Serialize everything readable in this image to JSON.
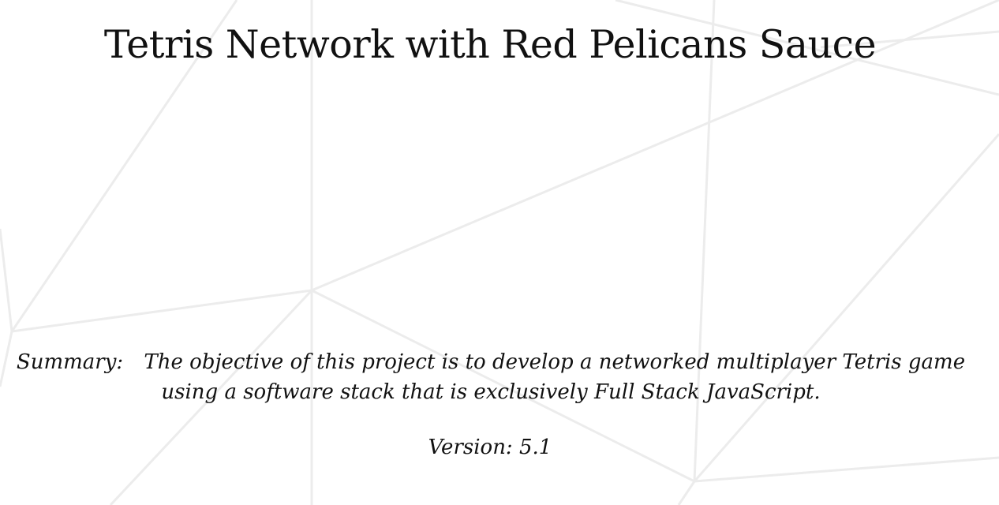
{
  "document": {
    "title": "Tetris Network with Red Pelicans Sauce",
    "summary": {
      "label": "Summary:",
      "text": "The objective of this project is to develop a networked multiplayer Tetris game using a software stack that is exclusively Full Stack JavaScript."
    },
    "version": {
      "label": "Version:",
      "value": "5.1"
    }
  }
}
